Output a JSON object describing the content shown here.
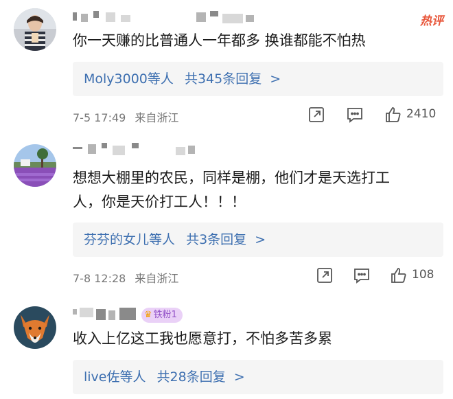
{
  "hot_label": "热评",
  "comments": [
    {
      "text": "你一天赚的比普通人一年都多 换谁都能不怕热",
      "replies": {
        "who": "Moly3000等人",
        "count": "共345条回复",
        "arrow": ">"
      },
      "date": "7-5 17:49",
      "location": "来自浙江",
      "likes": "2410"
    },
    {
      "text_line1": "想想大棚里的农民，同样是棚，他们才是天选打工",
      "text_line2": "人，你是天价打工人！！！",
      "replies": {
        "who": "芬芬的女儿等人",
        "count": "共3条回复",
        "arrow": ">"
      },
      "date": "7-8 12:28",
      "location": "来自浙江",
      "likes": "108"
    },
    {
      "badge": "铁粉1",
      "text": "收入上亿这工我也愿意打，不怕多苦多累",
      "replies": {
        "who": "live佐等人",
        "count": "共28条回复",
        "arrow": ">"
      }
    }
  ],
  "icons": [
    "share-icon",
    "comment-icon",
    "like-icon",
    "crown-icon"
  ],
  "colors": {
    "reply_link": "#3d6fb0",
    "hot": "#e8563a",
    "badge_bg": "#ead1f7"
  }
}
